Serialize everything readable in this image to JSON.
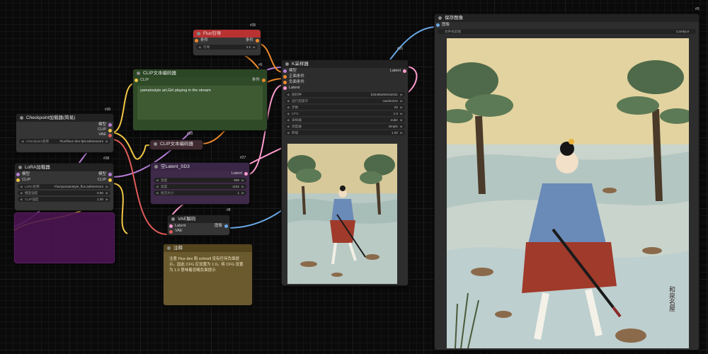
{
  "colors": {
    "canvas": "#0a0a0a",
    "node_body": "#353535",
    "clip_green": "#2f4a27",
    "flux_red": "#b83232",
    "latent_purple": "#3f2a4a",
    "note_brown": "#6b5a2e",
    "lora_magenta": "#5a1a5a"
  },
  "nodes": {
    "flux_guidance": {
      "id": "#35",
      "title": "Flux引导",
      "in_label": "条件",
      "out_label": "条件",
      "widget_label": "引导",
      "widget_value": "3.5"
    },
    "clip_pos": {
      "id": "#6",
      "title": "CLIP文本编码器",
      "in_label": "CLIP",
      "out_label": "条件",
      "text": "yamatostyle art,Girl playing in the stream"
    },
    "clip_neg": {
      "id": "#33",
      "title": "CLIP文本编码器"
    },
    "checkpoint": {
      "id": "#30",
      "title": "Checkpoint加载器(简易)",
      "out_model": "模型",
      "out_clip": "CLIP",
      "out_vae": "VAE",
      "widget_label": "Checkpoint名称",
      "widget_value": "Flux\\flux1-dev-fp8.safetensors"
    },
    "lora": {
      "id": "#38",
      "title": "LoRA加载器",
      "io_model": "模型",
      "io_clip": "CLIP",
      "widgets": [
        {
          "label": "LoRA名称",
          "value": "Flux\\yamatostyle_flux.safetensors"
        },
        {
          "label": "模型强度",
          "value": "0.80"
        },
        {
          "label": "CLIP强度",
          "value": "1.00"
        }
      ]
    },
    "empty_latent": {
      "id": "#27",
      "title": "空Latent_SD3",
      "out_label": "Latent",
      "widgets": [
        {
          "label": "宽度",
          "value": "896"
        },
        {
          "label": "高度",
          "value": "1152"
        },
        {
          "label": "批次大小",
          "value": "1"
        }
      ]
    },
    "ksampler": {
      "id": "#31",
      "title": "K采样器",
      "out_label": "Latent",
      "inputs": [
        "模型",
        "正面条件",
        "负面条件",
        "Latent"
      ],
      "widgets": [
        {
          "label": "随机种",
          "value": "533485208152031"
        },
        {
          "label": "运行后操作",
          "value": "randomize"
        },
        {
          "label": "步数",
          "value": "20"
        },
        {
          "label": "CFG",
          "value": "1.0"
        },
        {
          "label": "采样器",
          "value": "euler"
        },
        {
          "label": "调度器",
          "value": "simple"
        },
        {
          "label": "降噪",
          "value": "1.00"
        }
      ]
    },
    "vae_decode": {
      "id": "#8",
      "title": "VAE解码",
      "in_latent": "Latent",
      "in_vae": "VAE",
      "out_label": "图像"
    },
    "note": {
      "title": "注释",
      "text": "注意 Flux dev 和 schnell 没有任何负面提示。因此 CFG 应设置为 1.0。将 CFG 设置为 1.0 意味着忽略负面提示"
    },
    "save_image": {
      "id": "#9",
      "title": "保存图像",
      "in_label": "图像",
      "widget_label": "文件名前缀",
      "widget_value": "ComfyUI"
    }
  },
  "images": {
    "preview_alt": "ukiyo-e painting of a girl with a sword crossing a stream",
    "signature": "和泉名屋"
  }
}
